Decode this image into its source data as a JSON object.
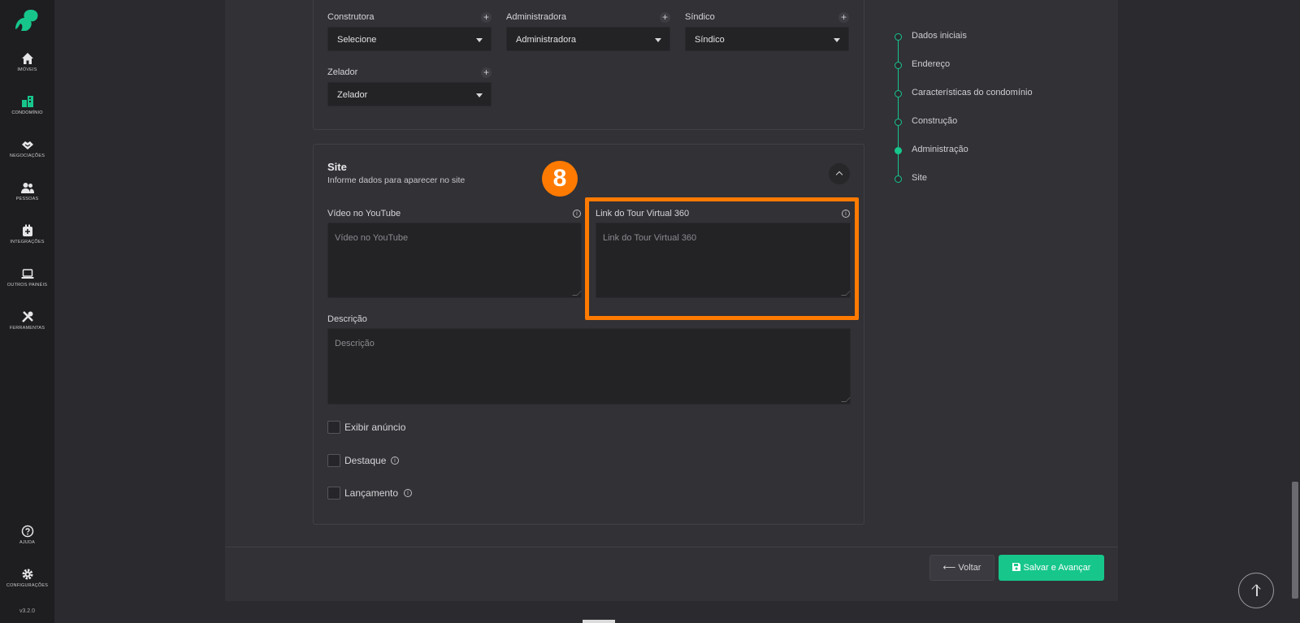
{
  "sidebar": {
    "version": "v3.2.0",
    "items": [
      {
        "label": "IMÓVEIS",
        "icon": "home-icon"
      },
      {
        "label": "CONDOMÍNIO",
        "icon": "building-icon"
      },
      {
        "label": "NEGOCIAÇÕES",
        "icon": "handshake-icon"
      },
      {
        "label": "PESSOAS",
        "icon": "people-icon"
      },
      {
        "label": "INTEGRAÇÕES",
        "icon": "plug-icon"
      },
      {
        "label": "OUTROS PAINÉIS",
        "icon": "laptop-icon"
      },
      {
        "label": "FERRAMENTAS",
        "icon": "tools-icon"
      }
    ],
    "bottom_items": [
      {
        "label": "AJUDA",
        "icon": "help-icon"
      },
      {
        "label": "CONFIGURAÇÕES",
        "icon": "gear-icon"
      }
    ]
  },
  "admin": {
    "construtora": {
      "label": "Construtora",
      "value": "Selecione"
    },
    "administradora": {
      "label": "Administradora",
      "value": "Administradora"
    },
    "sindico": {
      "label": "Síndico",
      "value": "Síndico"
    },
    "zelador": {
      "label": "Zelador",
      "value": "Zelador"
    }
  },
  "site": {
    "title": "Site",
    "subtitle": "Informe dados para aparecer no site",
    "youtube": {
      "label": "Vídeo no YouTube",
      "placeholder": "Vídeo no YouTube"
    },
    "tour": {
      "label": "Link do Tour Virtual 360",
      "placeholder": "Link do Tour Virtual 360"
    },
    "descricao": {
      "label": "Descrição",
      "placeholder": "Descrição"
    },
    "checkboxes": [
      {
        "label": "Exibir anúncio",
        "info": false
      },
      {
        "label": "Destaque",
        "info": true
      },
      {
        "label": "Lançamento",
        "info": true
      }
    ]
  },
  "annotation": {
    "badge": "8",
    "color": "#ff7a00"
  },
  "steps": [
    {
      "label": "Dados iniciais",
      "active": false
    },
    {
      "label": "Endereço",
      "active": false
    },
    {
      "label": "Características do condomínio",
      "active": false
    },
    {
      "label": "Construção",
      "active": false
    },
    {
      "label": "Administração",
      "active": true
    },
    {
      "label": "Site",
      "active": false
    }
  ],
  "footer": {
    "back_label": "Voltar",
    "save_label": "Salvar e Avançar"
  },
  "colors": {
    "accent": "#17c68b",
    "background": "#2b2b2f",
    "panel": "#313136"
  }
}
